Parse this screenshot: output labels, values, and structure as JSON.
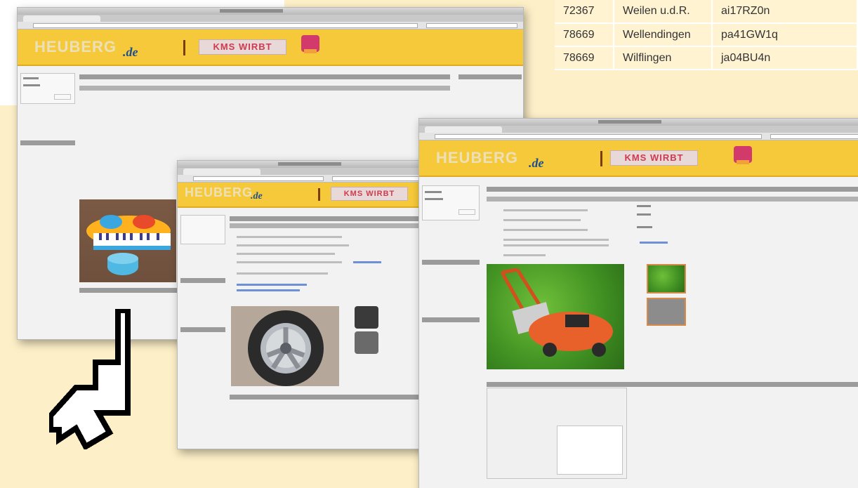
{
  "code_table": [
    {
      "plz": "72367",
      "ort": "Weilen u.d.R.",
      "code": "ai17RZ0n"
    },
    {
      "plz": "78669",
      "ort": "Wellendingen",
      "code": "pa41GW1q"
    },
    {
      "plz": "78669",
      "ort": "Wilflingen",
      "code": "ja04BU4n"
    }
  ],
  "browser": {
    "logo": "HEUBERG",
    "logo_suffix": ".de",
    "ad_text": "KMS WIRBT"
  },
  "colors": {
    "background": "#fdf0c8",
    "banner": "#f6c93a",
    "table_bg": "#fff3d2"
  },
  "icons": [
    "mouse-cursor-icon"
  ]
}
